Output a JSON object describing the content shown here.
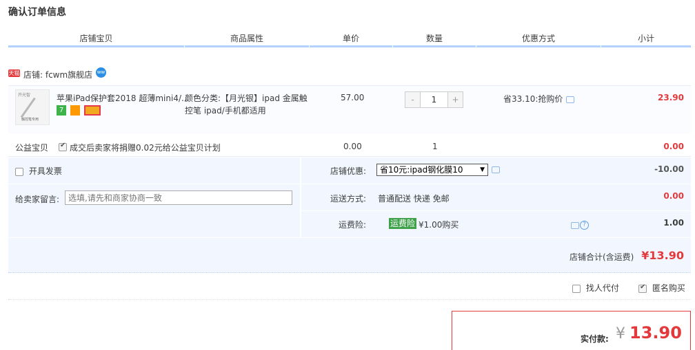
{
  "page_title": "确认订单信息",
  "columns": [
    "店铺宝贝",
    "商品属性",
    "单价",
    "数量",
    "优惠方式",
    "小计"
  ],
  "shop": {
    "badge": "天猫",
    "name": "店铺: fcwm旗舰店",
    "ww_badge": "ww"
  },
  "item": {
    "thumb_top": "开光智",
    "thumb_bottom": "触控笔专用",
    "title": "苹果iPad保护套2018 超薄mini4/...",
    "svc_label": "7",
    "attr": "颜色分类:【月光银】ipad 金属触控笔 ipad/手机都适用",
    "price": "57.00",
    "qty_minus": "-",
    "qty": "1",
    "qty_plus": "+",
    "discount": "省33.10:抢购价",
    "subtotal": "23.90"
  },
  "charity": {
    "label": "公益宝贝",
    "text": "成交后卖家将捐赠0.02元给公益宝贝计划",
    "price": "0.00",
    "qty": "1",
    "subtotal": "0.00"
  },
  "invoice_label": "开具发票",
  "message": {
    "label": "给卖家留言:",
    "placeholder": "选填,请先和商家协商一致"
  },
  "shop_promo": {
    "label": "店铺优惠:",
    "selected": "省10元:ipad钢化膜10",
    "value": "-10.00"
  },
  "shipping": {
    "label": "运送方式:",
    "text": "普通配送 快递 免邮",
    "value": "0.00"
  },
  "insurance": {
    "label": "运费险:",
    "badge": "运费险",
    "text": "¥1.00购买",
    "help": "?",
    "value": "1.00"
  },
  "shop_total": {
    "label": "店铺合计(含运费)",
    "value": "¥13.90"
  },
  "options": {
    "proxy_label": "找人代付",
    "anon_label": "匿名购买"
  },
  "payment": {
    "label": "实付款:",
    "currency": "¥",
    "value": "13.90"
  },
  "colors": {
    "accent_red": "#e4393c",
    "header_line": "#b2d1ff",
    "panel_bg": "#f2f7ff"
  }
}
